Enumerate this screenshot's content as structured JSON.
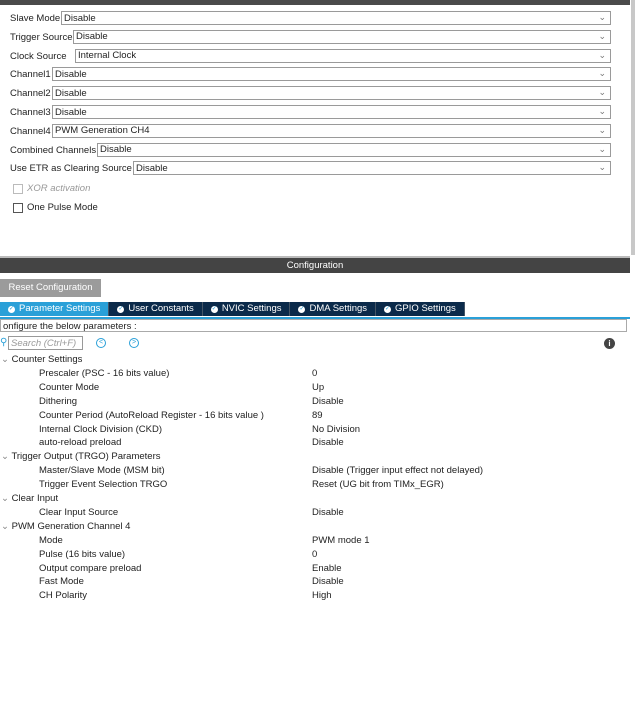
{
  "mode": {
    "fields": [
      {
        "label": "Slave Mode",
        "value": "Disable"
      },
      {
        "label": "Trigger Source",
        "value": "Disable"
      },
      {
        "label": "Clock Source",
        "value": "Internal Clock"
      },
      {
        "label": "Channel1",
        "value": "Disable"
      },
      {
        "label": "Channel2",
        "value": "Disable"
      },
      {
        "label": "Channel3",
        "value": "Disable"
      },
      {
        "label": "Channel4",
        "value": "PWM Generation CH4"
      },
      {
        "label": "Combined Channels",
        "value": "Disable"
      },
      {
        "label": "Use ETR as Clearing Source",
        "value": "Disable"
      }
    ],
    "xor": "XOR activation",
    "one_pulse": "One Pulse Mode"
  },
  "config": {
    "title": "Configuration",
    "reset": "Reset Configuration",
    "tabs": [
      "Parameter Settings",
      "User Constants",
      "NVIC Settings",
      "DMA Settings",
      "GPIO Settings"
    ],
    "hint": "onfigure the below parameters :",
    "search_placeholder": "Search (Ctrl+F)",
    "tree": [
      {
        "group": "Counter Settings",
        "items": [
          [
            "Prescaler (PSC - 16 bits value)",
            "0"
          ],
          [
            "Counter Mode",
            "Up"
          ],
          [
            "Dithering",
            "Disable"
          ],
          [
            "Counter Period (AutoReload Register - 16 bits value )",
            "89"
          ],
          [
            "Internal Clock Division (CKD)",
            "No Division"
          ],
          [
            "auto-reload preload",
            "Disable"
          ]
        ]
      },
      {
        "group": "Trigger Output (TRGO) Parameters",
        "items": [
          [
            "Master/Slave Mode (MSM bit)",
            "Disable (Trigger input effect not delayed)"
          ],
          [
            "Trigger Event Selection TRGO",
            "Reset (UG bit from TIMx_EGR)"
          ]
        ]
      },
      {
        "group": "Clear Input",
        "items": [
          [
            "Clear Input Source",
            "Disable"
          ]
        ]
      },
      {
        "group": "PWM Generation Channel 4",
        "items": [
          [
            "Mode",
            "PWM mode 1"
          ],
          [
            "Pulse (16 bits value)",
            "0"
          ],
          [
            "Output compare preload",
            "Enable"
          ],
          [
            "Fast Mode",
            "Disable"
          ],
          [
            "CH Polarity",
            "High"
          ]
        ]
      }
    ]
  }
}
